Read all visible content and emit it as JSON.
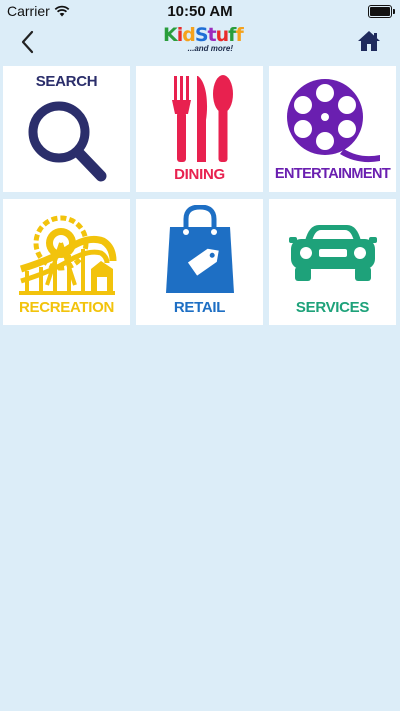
{
  "status_bar": {
    "carrier": "Carrier",
    "time": "10:50 AM"
  },
  "nav": {
    "logo_text": "KidStuff",
    "logo_sub": "...and more!",
    "back_icon": "chevron-left-icon",
    "home_icon": "home-icon"
  },
  "tiles": [
    {
      "label": "SEARCH",
      "icon": "magnifier-icon",
      "color": "#2b2e6b"
    },
    {
      "label": "DINING",
      "icon": "fork-knife-spoon-icon",
      "color": "#e8214f"
    },
    {
      "label": "ENTERTAINMENT",
      "icon": "film-reel-icon",
      "color": "#6a1fb0"
    },
    {
      "label": "RECREATION",
      "icon": "roller-coaster-icon",
      "color": "#f2c30c"
    },
    {
      "label": "RETAIL",
      "icon": "shopping-bag-icon",
      "color": "#1e6fc4"
    },
    {
      "label": "SERVICES",
      "icon": "car-icon",
      "color": "#1ea27a"
    }
  ]
}
